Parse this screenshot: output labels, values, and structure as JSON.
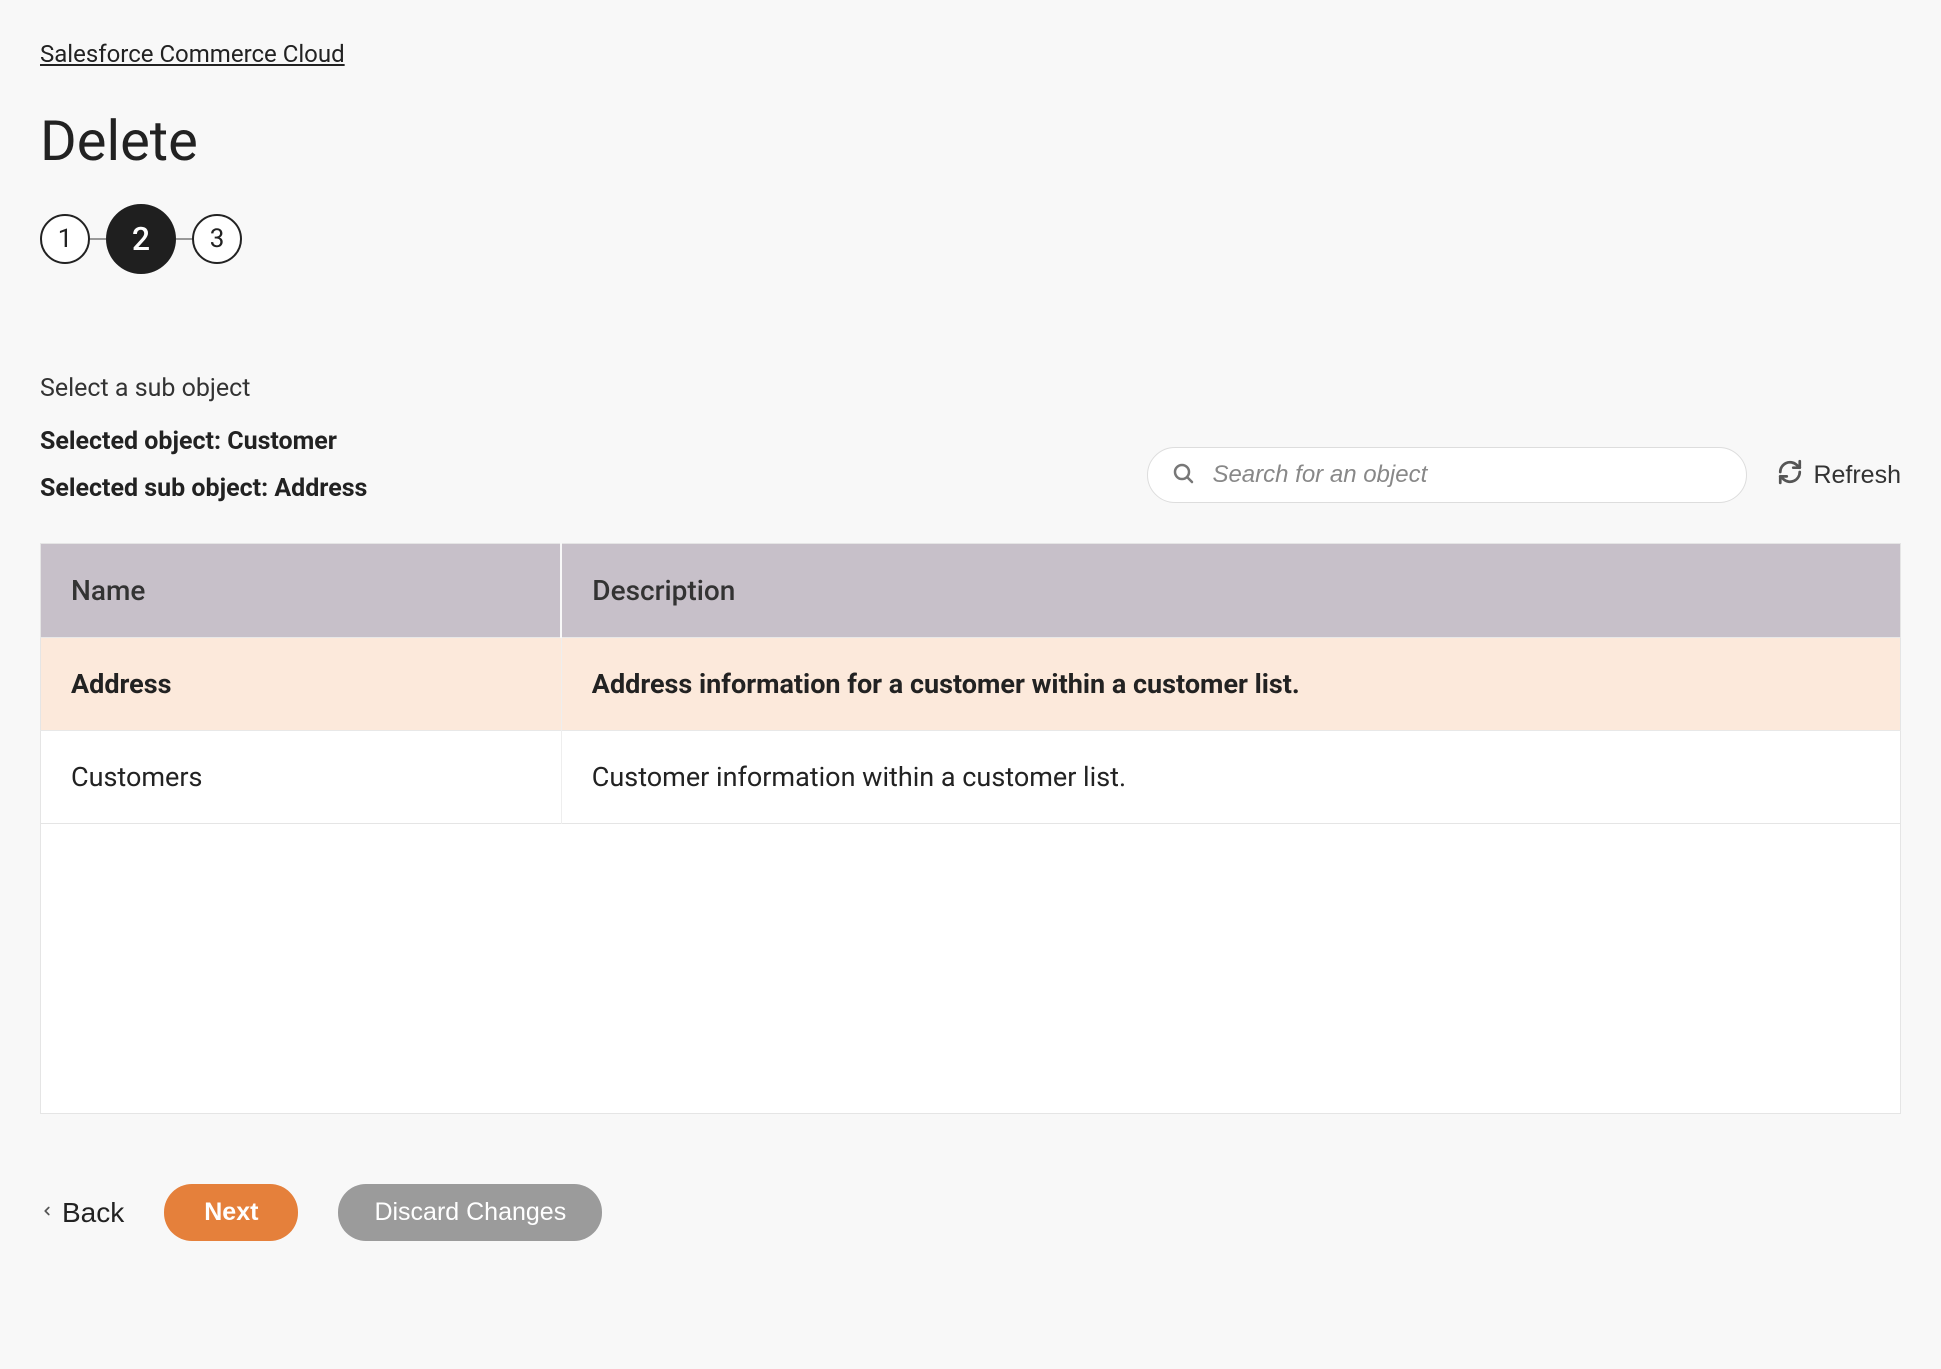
{
  "breadcrumb": "Salesforce Commerce Cloud",
  "page_title": "Delete",
  "stepper": {
    "steps": [
      "1",
      "2",
      "3"
    ],
    "active_index": 1
  },
  "section_label": "Select a sub object",
  "selected_object_line": "Selected object: Customer",
  "selected_sub_object_line": "Selected sub object: Address",
  "search": {
    "placeholder": "Search for an object",
    "value": ""
  },
  "refresh_label": "Refresh",
  "table": {
    "columns": {
      "name": "Name",
      "description": "Description"
    },
    "rows": [
      {
        "name": "Address",
        "description": "Address information for a customer within a customer list.",
        "selected": true
      },
      {
        "name": "Customers",
        "description": "Customer information within a customer list.",
        "selected": false
      }
    ]
  },
  "footer": {
    "back": "Back",
    "next": "Next",
    "discard": "Discard Changes"
  }
}
